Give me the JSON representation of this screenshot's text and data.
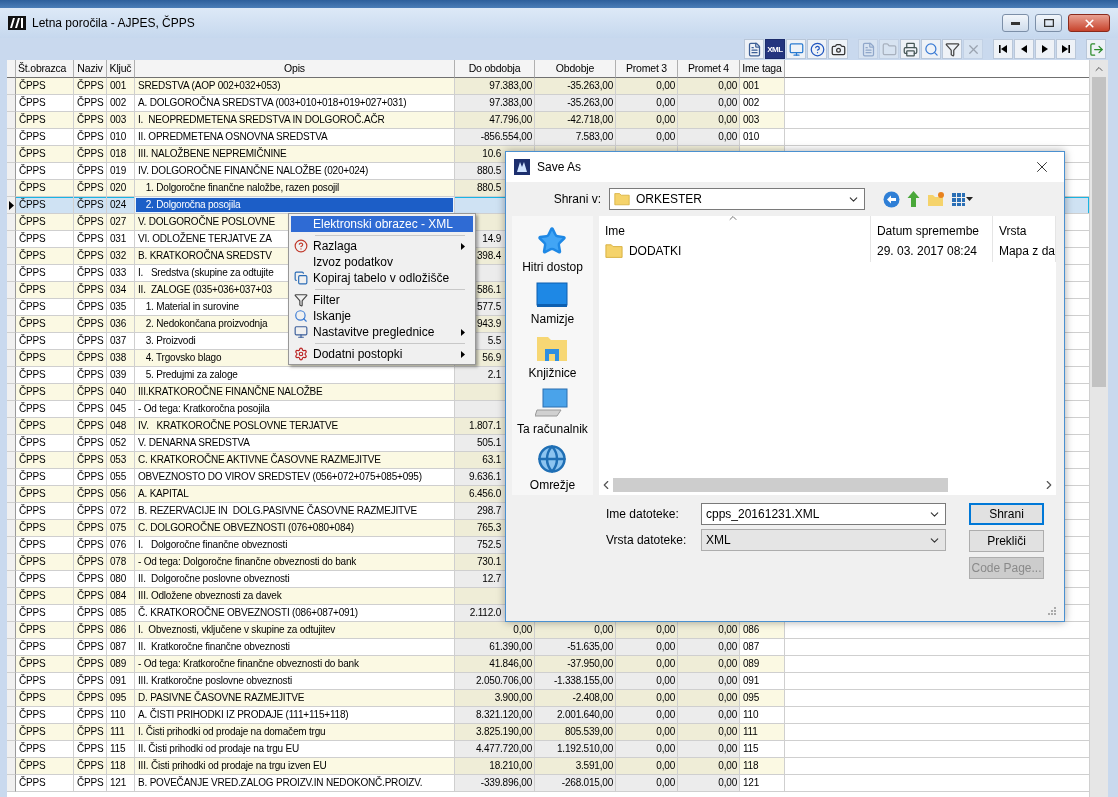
{
  "window": {
    "title": "Letna poročila - AJPES, ČPPS"
  },
  "toolbar": {
    "groups": [
      [
        {
          "disabled": false
        },
        {
          "label": "XML",
          "disabled": false
        },
        {
          "disabled": false
        },
        {
          "disabled": false
        },
        {
          "disabled": false
        }
      ],
      [
        {
          "disabled": true
        },
        {
          "disabled": true
        },
        {
          "disabled": false
        },
        {
          "disabled": false
        },
        {
          "disabled": false
        },
        {
          "disabled": true
        }
      ],
      [
        {
          "disabled": false
        },
        {
          "disabled": false
        },
        {
          "disabled": false
        },
        {
          "disabled": false
        }
      ],
      [
        {
          "disabled": false
        }
      ]
    ]
  },
  "table": {
    "columns": [
      "Št.obrazca",
      "Naziv",
      "Ključ",
      "Opis",
      "Do obdobja",
      "Obdobje",
      "Promet 3",
      "Promet 4",
      "Ime taga"
    ],
    "rows": [
      {
        "form": "ČPPS",
        "name": "ČPPS",
        "key": "001",
        "description": "SREDSTVA (AOP 002+032+053)",
        "to_date": "97.383,00",
        "period": "-35.263,00",
        "turnover_3": "0,00",
        "turnover_4": "0,00",
        "tag": "001",
        "selected": false
      },
      {
        "form": "ČPPS",
        "name": "ČPPS",
        "key": "002",
        "description": "A. DOLGOROČNA SREDSTVA (003+010+018+019+027+031)",
        "to_date": "97.383,00",
        "period": "-35.263,00",
        "turnover_3": "0,00",
        "turnover_4": "0,00",
        "tag": "002",
        "selected": false
      },
      {
        "form": "ČPPS",
        "name": "ČPPS",
        "key": "003",
        "description": "I.  NEOPREDMETENA SREDSTVA IN DOLGOROČ.AČR",
        "to_date": "47.796,00",
        "period": "-42.718,00",
        "turnover_3": "0,00",
        "turnover_4": "0,00",
        "tag": "003",
        "selected": false
      },
      {
        "form": "ČPPS",
        "name": "ČPPS",
        "key": "010",
        "description": "II. OPREDMETENA OSNOVNA SREDSTVA",
        "to_date": "-856.554,00",
        "period": "7.583,00",
        "turnover_3": "0,00",
        "turnover_4": "0,00",
        "tag": "010",
        "selected": false
      },
      {
        "form": "ČPPS",
        "name": "ČPPS",
        "key": "018",
        "description": "III. NALOŽBENE NEPREMIČNINE",
        "to_date": "10.6",
        "selected": false
      },
      {
        "form": "ČPPS",
        "name": "ČPPS",
        "key": "019",
        "description": "IV. DOLGOROČNE FINANČNE NALOŽBE (020+024)",
        "to_date": "880.5",
        "selected": false
      },
      {
        "form": "ČPPS",
        "name": "ČPPS",
        "key": "020",
        "description": "   1. Dolgoročne finančne naložbe, razen posojil",
        "to_date": "880.5",
        "selected": false
      },
      {
        "form": "ČPPS",
        "name": "ČPPS",
        "key": "024",
        "description": "   2. Dolgoročna posojila",
        "selected": true
      },
      {
        "form": "ČPPS",
        "name": "ČPPS",
        "key": "027",
        "description": "V. DOLGOROČNE POSLOVNE",
        "selected": false
      },
      {
        "form": "ČPPS",
        "name": "ČPPS",
        "key": "031",
        "description": "VI. ODLOŽENE TERJATVE ZA",
        "to_date": "14.9",
        "selected": false
      },
      {
        "form": "ČPPS",
        "name": "ČPPS",
        "key": "032",
        "description": "B. KRATKOROČNA SREDSTV",
        "to_date": "398.4",
        "selected": false
      },
      {
        "form": "ČPPS",
        "name": "ČPPS",
        "key": "033",
        "description": "I.   Sredstva (skupine za odtujite",
        "selected": false
      },
      {
        "form": "ČPPS",
        "name": "ČPPS",
        "key": "034",
        "description": "II.  ZALOGE (035+036+037+03",
        "to_date": "586.1",
        "selected": false
      },
      {
        "form": "ČPPS",
        "name": "ČPPS",
        "key": "035",
        "description": "   1. Material in surovine",
        "to_date": "577.5",
        "selected": false
      },
      {
        "form": "ČPPS",
        "name": "ČPPS",
        "key": "036",
        "description": "   2. Nedokončana proizvodnja",
        "to_date": "943.9",
        "selected": false
      },
      {
        "form": "ČPPS",
        "name": "ČPPS",
        "key": "037",
        "description": "   3. Proizvodi",
        "to_date": "5.5",
        "selected": false
      },
      {
        "form": "ČPPS",
        "name": "ČPPS",
        "key": "038",
        "description": "   4. Trgovsko blago",
        "to_date": "56.9",
        "selected": false
      },
      {
        "form": "ČPPS",
        "name": "ČPPS",
        "key": "039",
        "description": "   5. Predujmi za zaloge",
        "to_date": "2.1",
        "selected": false
      },
      {
        "form": "ČPPS",
        "name": "ČPPS",
        "key": "040",
        "description": "III.KRATKOROČNE FINANČNE NALOŽBE",
        "selected": false
      },
      {
        "form": "ČPPS",
        "name": "ČPPS",
        "key": "045",
        "description": "- Od tega: Kratkoročna posojila",
        "selected": false
      },
      {
        "form": "ČPPS",
        "name": "ČPPS",
        "key": "048",
        "description": "IV.   KRATKOROČNE POSLOVNE TERJATVE",
        "to_date": "1.807.1",
        "selected": false
      },
      {
        "form": "ČPPS",
        "name": "ČPPS",
        "key": "052",
        "description": "V. DENARNA SREDSTVA",
        "to_date": "505.1",
        "selected": false
      },
      {
        "form": "ČPPS",
        "name": "ČPPS",
        "key": "053",
        "description": "C. KRATKOROČNE AKTIVNE ČASOVNE RAZMEJITVE",
        "to_date": "63.1",
        "selected": false
      },
      {
        "form": "ČPPS",
        "name": "ČPPS",
        "key": "055",
        "description": "OBVEZNOSTO DO VIROV SREDSTEV (056+072+075+085+095)",
        "to_date": "9.636.1",
        "selected": false
      },
      {
        "form": "ČPPS",
        "name": "ČPPS",
        "key": "056",
        "description": "A. KAPITAL",
        "to_date": "6.456.0",
        "selected": false
      },
      {
        "form": "ČPPS",
        "name": "ČPPS",
        "key": "072",
        "description": "B. REZERVACIJE IN  DOLG.PASIVNE ČASOVNE RAZMEJITVE",
        "to_date": "298.7",
        "selected": false
      },
      {
        "form": "ČPPS",
        "name": "ČPPS",
        "key": "075",
        "description": "C. DOLGOROČNE OBVEZNOSTI (076+080+084)",
        "to_date": "765.3",
        "selected": false
      },
      {
        "form": "ČPPS",
        "name": "ČPPS",
        "key": "076",
        "description": "I.   Dolgoročne finančne obveznosti",
        "to_date": "752.5",
        "selected": false
      },
      {
        "form": "ČPPS",
        "name": "ČPPS",
        "key": "078",
        "description": "- Od tega: Dolgoročne finančne obveznosti do bank",
        "to_date": "730.1",
        "selected": false
      },
      {
        "form": "ČPPS",
        "name": "ČPPS",
        "key": "080",
        "description": "II.  Dolgoročne poslovne obveznosti",
        "to_date": "12.7",
        "selected": false
      },
      {
        "form": "ČPPS",
        "name": "ČPPS",
        "key": "084",
        "description": "III. Odložene obveznosti za davek",
        "selected": false
      },
      {
        "form": "ČPPS",
        "name": "ČPPS",
        "key": "085",
        "description": "Č. KRATKOROČNE OBVEZNOSTI (086+087+091)",
        "to_date": "2.112.0",
        "selected": false
      },
      {
        "form": "ČPPS",
        "name": "ČPPS",
        "key": "086",
        "description": "I.  Obveznosti, vključene v skupine za odtujitev",
        "to_date": "0,00",
        "period": "0,00",
        "turnover_3": "0,00",
        "turnover_4": "0,00",
        "tag": "086",
        "selected": false
      },
      {
        "form": "ČPPS",
        "name": "ČPPS",
        "key": "087",
        "description": "II.  Kratkoročne finančne obveznosti",
        "to_date": "61.390,00",
        "period": "-51.635,00",
        "turnover_3": "0,00",
        "turnover_4": "0,00",
        "tag": "087",
        "selected": false
      },
      {
        "form": "ČPPS",
        "name": "ČPPS",
        "key": "089",
        "description": "- Od tega: Kratkoročne finančne obveznosti do bank",
        "to_date": "41.846,00",
        "period": "-37.950,00",
        "turnover_3": "0,00",
        "turnover_4": "0,00",
        "tag": "089",
        "selected": false
      },
      {
        "form": "ČPPS",
        "name": "ČPPS",
        "key": "091",
        "description": "III. Kratkoročne poslovne obveznosti",
        "to_date": "2.050.706,00",
        "period": "-1.338.155,00",
        "turnover_3": "0,00",
        "turnover_4": "0,00",
        "tag": "091",
        "selected": false
      },
      {
        "form": "ČPPS",
        "name": "ČPPS",
        "key": "095",
        "description": "D. PASIVNE ČASOVNE RAZMEJITVE",
        "to_date": "3.900,00",
        "period": "-2.408,00",
        "turnover_3": "0,00",
        "turnover_4": "0,00",
        "tag": "095",
        "selected": false
      },
      {
        "form": "ČPPS",
        "name": "ČPPS",
        "key": "110",
        "description": "A. ČISTI PRIHODKI IZ PRODAJE (111+115+118)",
        "to_date": "8.321.120,00",
        "period": "2.001.640,00",
        "turnover_3": "0,00",
        "turnover_4": "0,00",
        "tag": "110",
        "selected": false
      },
      {
        "form": "ČPPS",
        "name": "ČPPS",
        "key": "111",
        "description": "I. Čisti prihodki od prodaje na domačem trgu",
        "to_date": "3.825.190,00",
        "period": "805.539,00",
        "turnover_3": "0,00",
        "turnover_4": "0,00",
        "tag": "111",
        "selected": false
      },
      {
        "form": "ČPPS",
        "name": "ČPPS",
        "key": "115",
        "description": "II. Čisti prihodki od prodaje na trgu EU",
        "to_date": "4.477.720,00",
        "period": "1.192.510,00",
        "turnover_3": "0,00",
        "turnover_4": "0,00",
        "tag": "115",
        "selected": false
      },
      {
        "form": "ČPPS",
        "name": "ČPPS",
        "key": "118",
        "description": "III. Čisti prihodki od prodaje na trgu izven EU",
        "to_date": "18.210,00",
        "period": "3.591,00",
        "turnover_3": "0,00",
        "turnover_4": "0,00",
        "tag": "118",
        "selected": false
      },
      {
        "form": "ČPPS",
        "name": "ČPPS",
        "key": "121",
        "description": "B. POVEČANJE VRED.ZALOG PROIZV.IN NEDOKONČ.PROIZV.",
        "to_date": "-339.896,00",
        "period": "-268.015,00",
        "turnover_3": "0,00",
        "turnover_4": "0,00",
        "tag": "121",
        "selected": false
      }
    ]
  },
  "context_menu": {
    "items": [
      {
        "kind": "item",
        "label": "Elektronski obrazec - XML",
        "selected": true,
        "submenu": false
      },
      {
        "kind": "separator"
      },
      {
        "kind": "item",
        "label": "Razlaga",
        "selected": false,
        "submenu": true
      },
      {
        "kind": "item",
        "label": "Izvoz podatkov",
        "selected": false,
        "submenu": false
      },
      {
        "kind": "item",
        "label": "Kopiraj tabelo v odložišče",
        "selected": false,
        "submenu": false
      },
      {
        "kind": "separator"
      },
      {
        "kind": "item",
        "label": "Filter",
        "selected": false,
        "submenu": false
      },
      {
        "kind": "item",
        "label": "Iskanje",
        "selected": false,
        "submenu": false
      },
      {
        "kind": "item",
        "label": "Nastavitve preglednice",
        "selected": false,
        "submenu": true
      },
      {
        "kind": "separator"
      },
      {
        "kind": "item",
        "label": "Dodatni postopki",
        "selected": false,
        "submenu": true
      }
    ]
  },
  "save_dialog": {
    "title": "Save As",
    "location_label": "Shrani v:",
    "location": "ORKESTER",
    "places": [
      "Hitri dostop",
      "Namizje",
      "Knjižnice",
      "Ta računalnik",
      "Omrežje"
    ],
    "file_list": {
      "columns": [
        "Ime",
        "Datum spremembe",
        "Vrsta"
      ],
      "rows": [
        {
          "name": "DODATKI",
          "modified": "29. 03. 2017 08:24",
          "type": "Mapa z da"
        }
      ]
    },
    "file_name_label": "Ime datoteke:",
    "file_name": "cpps_20161231.XML",
    "file_type_label": "Vrsta datoteke:",
    "file_type": "XML",
    "buttons": [
      {
        "label": "Shrani",
        "default": true,
        "disabled": false
      },
      {
        "label": "Prekliči",
        "default": false,
        "disabled": false
      },
      {
        "label": "Code Page...",
        "default": false,
        "disabled": true
      }
    ]
  }
}
